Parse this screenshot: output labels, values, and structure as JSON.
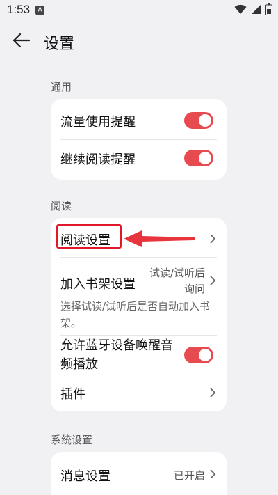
{
  "status_bar": {
    "time": "1:53",
    "notification_icon": "A"
  },
  "header": {
    "title": "设置",
    "back_icon": "arrow-left-icon"
  },
  "sections": {
    "general": {
      "label": "通用",
      "items": [
        {
          "label": "流量使用提醒",
          "toggle_on": true
        },
        {
          "label": "继续阅读提醒",
          "toggle_on": true
        }
      ]
    },
    "reading": {
      "label": "阅读",
      "reading_settings": {
        "label": "阅读设置"
      },
      "bookshelf": {
        "label": "加入书架设置",
        "value_line1": "试读/试听后",
        "value_line2": "询问",
        "description": "选择试读/试听后是否自动加入书架。"
      },
      "bluetooth": {
        "label_line1": "允许蓝牙设备唤醒音",
        "label_line2": "频播放",
        "toggle_on": true
      },
      "plugins": {
        "label": "插件"
      }
    },
    "system": {
      "label": "系统设置",
      "messages": {
        "label": "消息设置",
        "value": "已开启"
      }
    }
  },
  "colors": {
    "accent": "#e84b4f",
    "annotation": "#e0192a"
  }
}
